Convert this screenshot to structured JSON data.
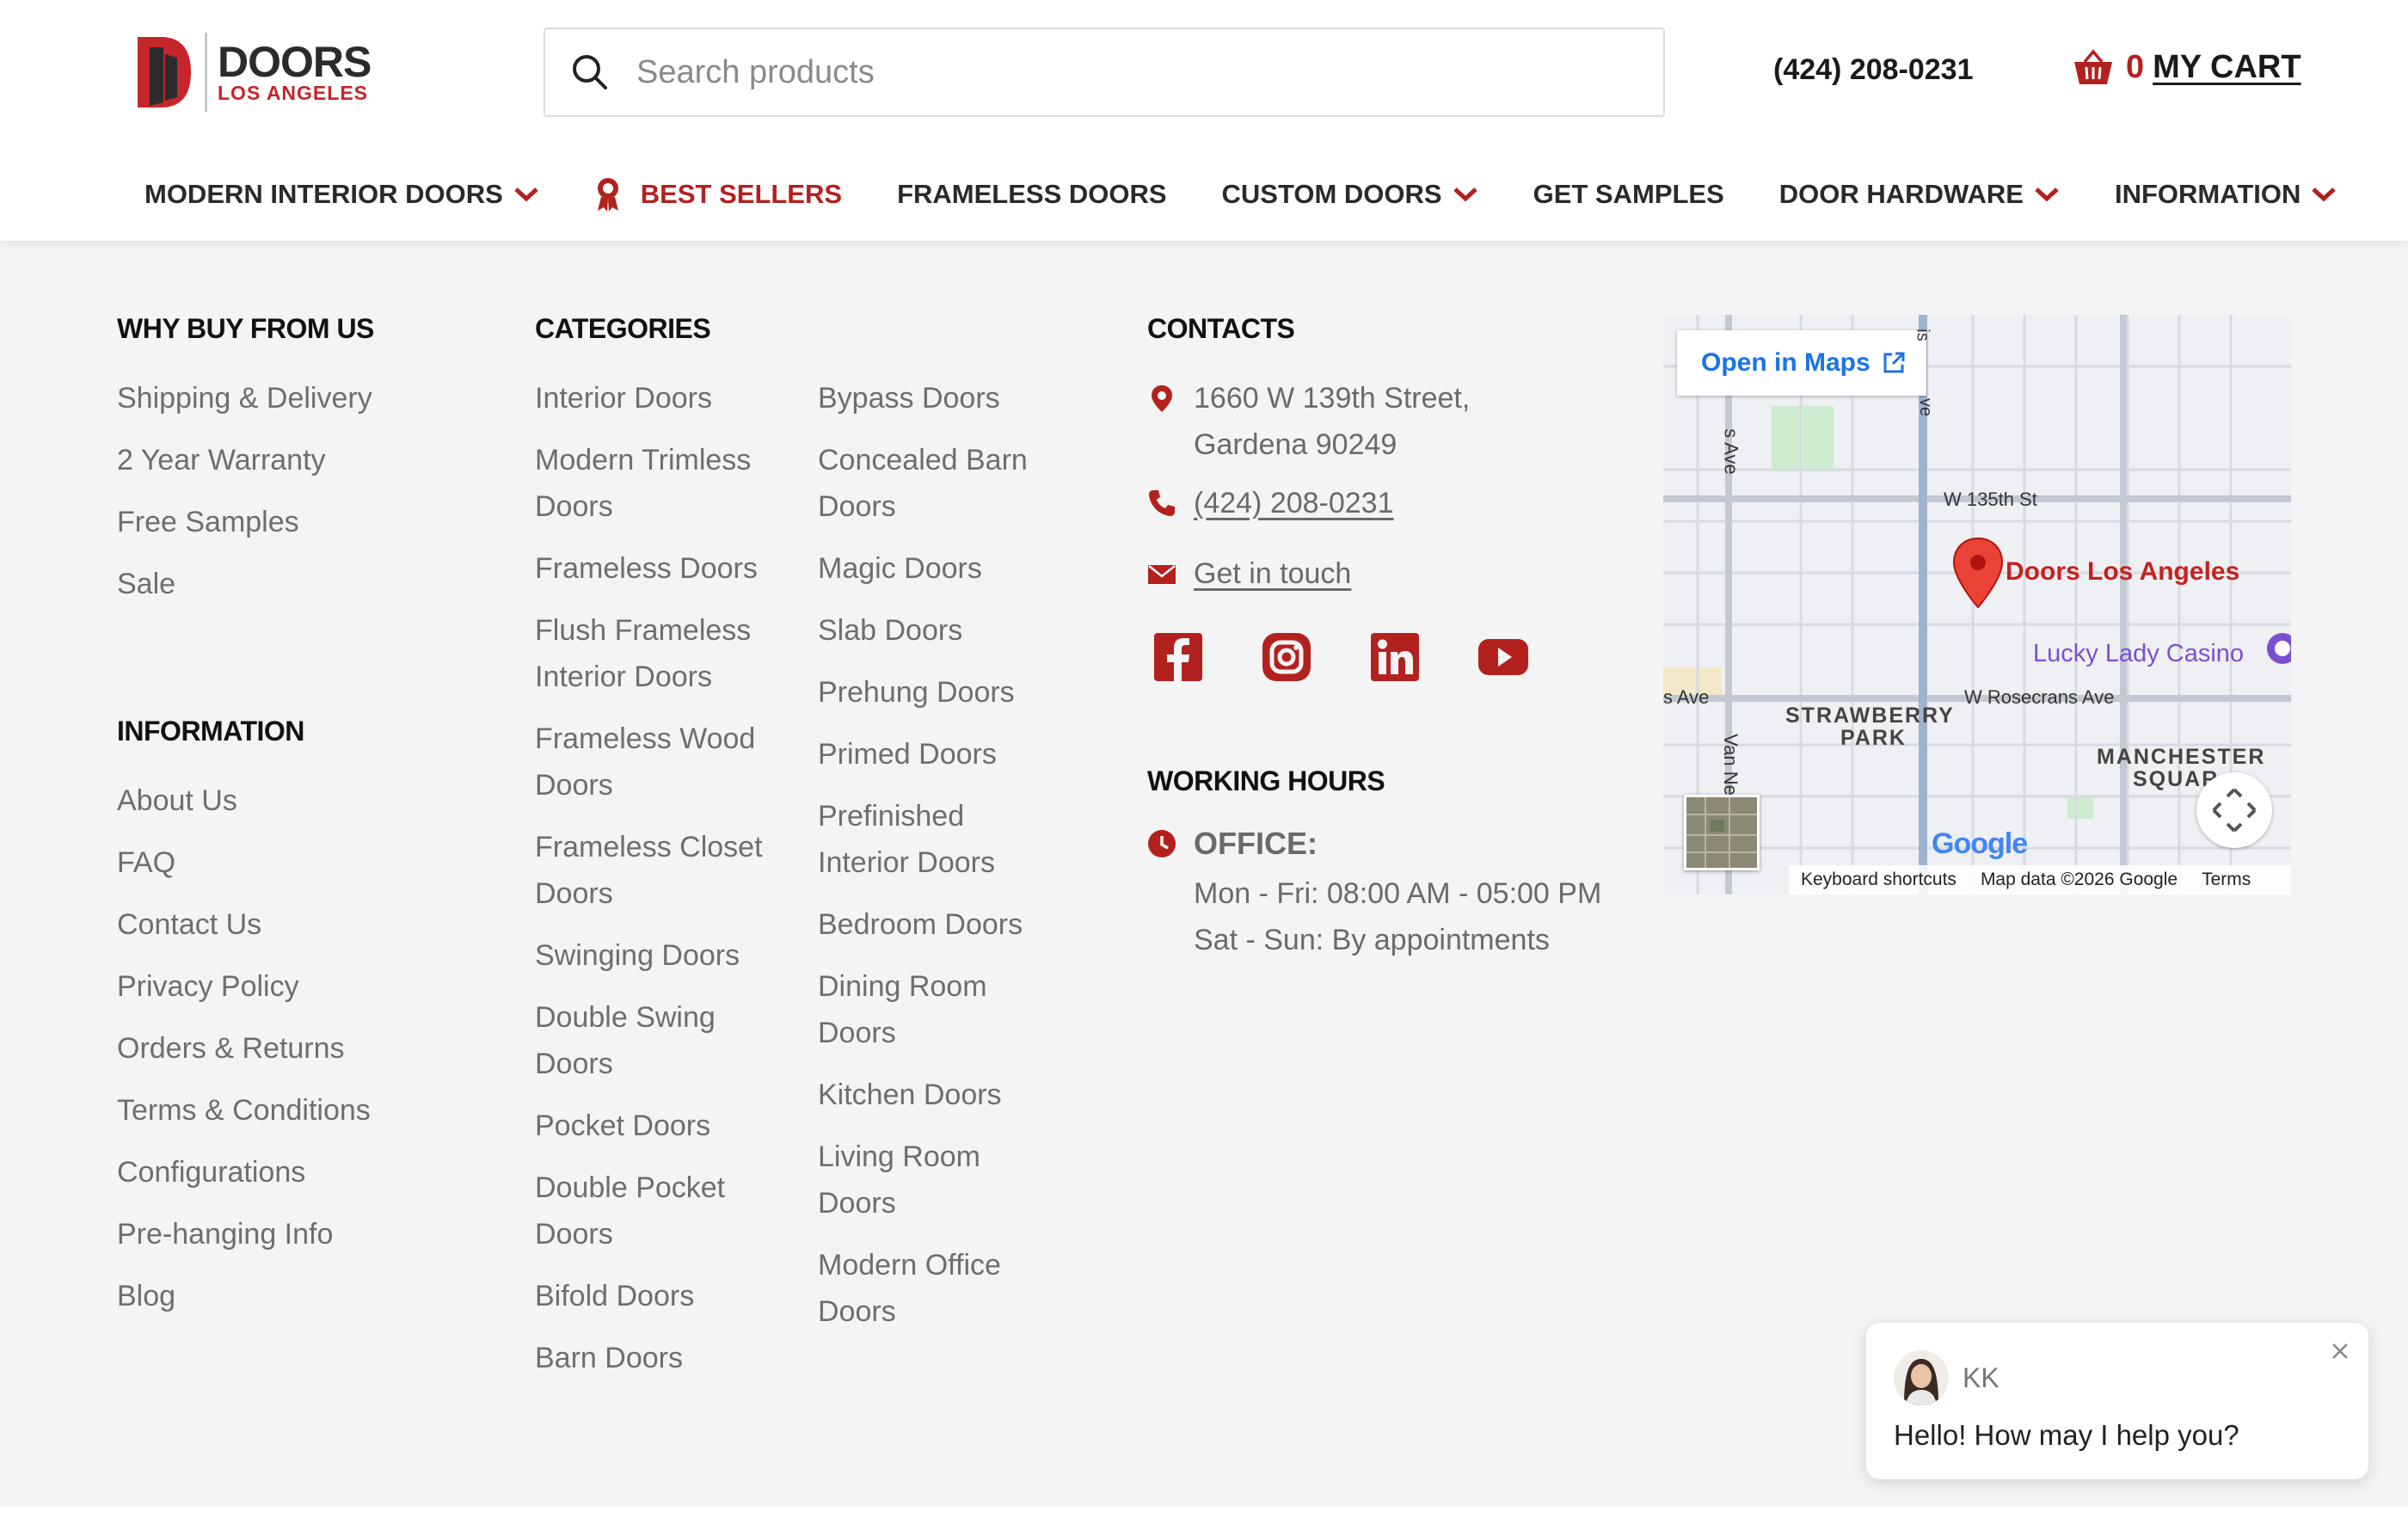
{
  "header": {
    "logo": {
      "word": "DOORS",
      "sub": "LOS ANGELES"
    },
    "search": {
      "placeholder": "Search products"
    },
    "phone": "(424) 208-0231",
    "cart": {
      "count": "0",
      "label": "MY CART"
    }
  },
  "nav": [
    {
      "label": "MODERN INTERIOR DOORS",
      "dropdown": true
    },
    {
      "label": "BEST SELLERS",
      "dropdown": false,
      "highlight": true,
      "icon": "award-ribbon-icon"
    },
    {
      "label": "FRAMELESS DOORS",
      "dropdown": false
    },
    {
      "label": "CUSTOM DOORS",
      "dropdown": true
    },
    {
      "label": "GET SAMPLES",
      "dropdown": false
    },
    {
      "label": "DOOR HARDWARE",
      "dropdown": true
    },
    {
      "label": "INFORMATION",
      "dropdown": true
    }
  ],
  "footer": {
    "why": {
      "title": "WHY BUY FROM US",
      "links": [
        "Shipping & Delivery",
        "2 Year Warranty",
        "Free Samples",
        "Sale"
      ]
    },
    "information": {
      "title": "INFORMATION",
      "links": [
        "About Us",
        "FAQ",
        "Contact Us",
        "Privacy Policy",
        "Orders & Returns",
        "Terms & Conditions",
        "Configurations",
        "Pre-hanging Info",
        "Blog"
      ]
    },
    "categories": {
      "title": "CATEGORIES",
      "col1": [
        "Interior Doors",
        "Modern Trimless Doors",
        "Frameless Doors",
        "Flush Frameless Interior Doors",
        "Frameless Wood Doors",
        "Frameless Closet Doors",
        "Swinging Doors",
        "Double Swing Doors",
        "Pocket Doors",
        "Double Pocket Doors",
        "Bifold Doors",
        "Barn Doors"
      ],
      "col2": [
        "Bypass Doors",
        "Concealed Barn Doors",
        "Magic Doors",
        "Slab Doors",
        "Prehung Doors",
        "Primed Doors",
        "Prefinished Interior Doors",
        "Bedroom Doors",
        "Dining Room Doors",
        "Kitchen Doors",
        "Living Room Doors",
        "Modern Office Doors"
      ]
    },
    "contacts": {
      "title": "CONTACTS",
      "address_line1": "1660 W 139th Street,",
      "address_line2": "Gardena 90249",
      "phone": "(424) 208-0231",
      "email_label": "Get in touch",
      "social": [
        "facebook-icon",
        "instagram-icon",
        "linkedin-icon",
        "youtube-icon"
      ]
    },
    "hours": {
      "title": "WORKING HOURS",
      "office_label": "OFFICE:",
      "weekdays": "Mon - Fri: 08:00 AM - 05:00 PM",
      "weekend": "Sat - Sun: By appointments"
    }
  },
  "map": {
    "open_label": "Open in Maps",
    "pin_label": "Doors Los Angeles",
    "casino": "Lucky Lady Casino",
    "streets": {
      "w135": "W 135th St",
      "rosecrans": "W Rosecrans Ave",
      "s_ave": "s Ave",
      "s_ave_vert": "s Ave",
      "van_ness": "Van Ne",
      "top_frag": "is",
      "ve_frag": "ve"
    },
    "areas": {
      "strawberry1": "STRAWBERRY",
      "strawberry2": "PARK",
      "manchester1": "MANCHESTER",
      "manchester2": "SQUAR"
    },
    "google": "Google",
    "footer": [
      "Keyboard shortcuts",
      "Map data ©2026 Google",
      "Terms"
    ]
  },
  "chat": {
    "name": "KK",
    "message": "Hello! How may I help you?"
  },
  "colors": {
    "brand_red": "#b3211f",
    "link_gray": "#6e6e6e",
    "map_blue": "#1a73e8"
  }
}
